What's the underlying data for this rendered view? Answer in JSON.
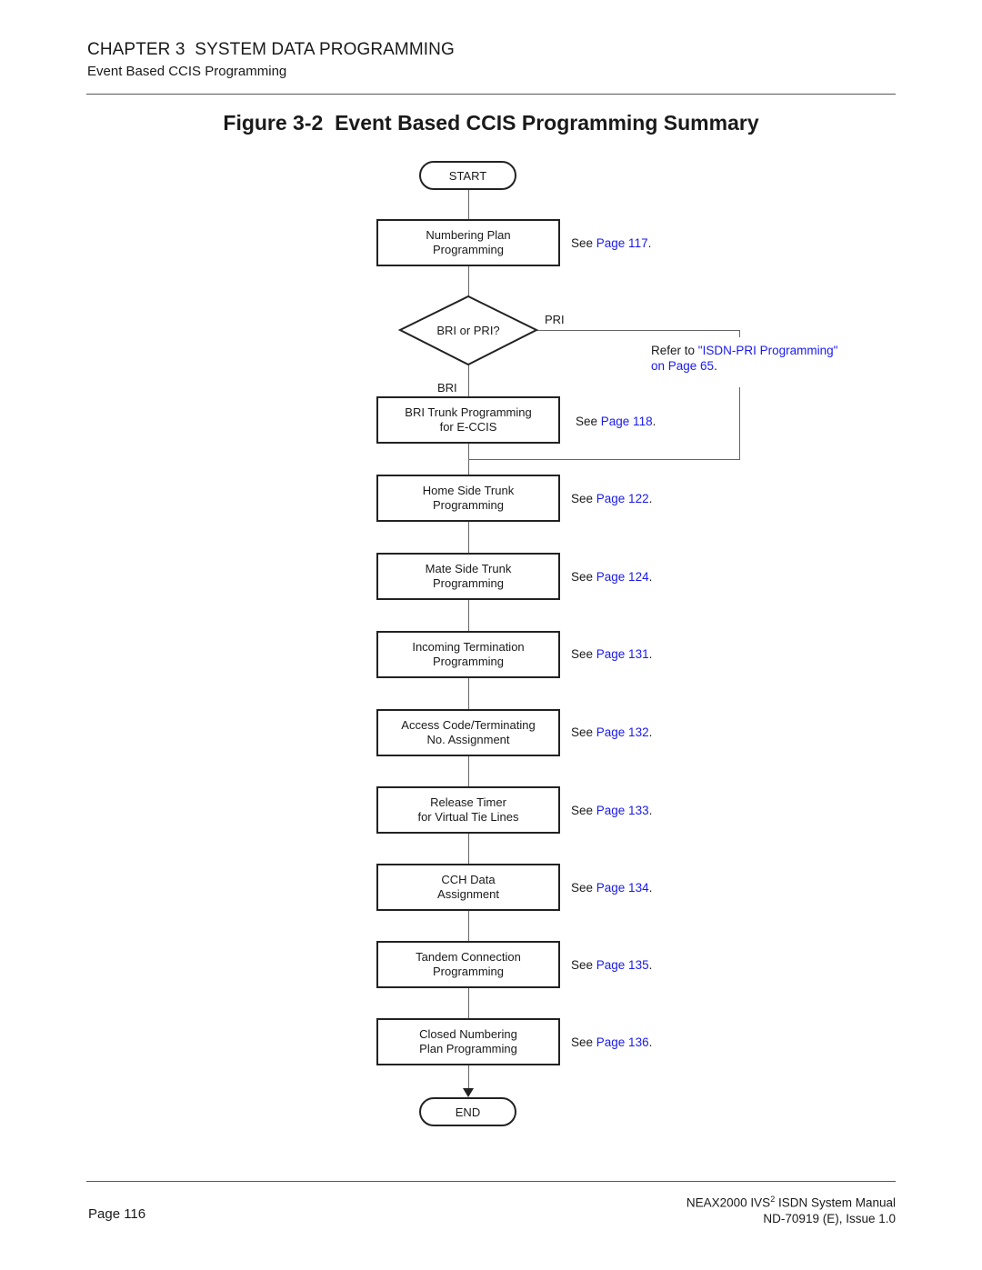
{
  "header": {
    "chapter": "CHAPTER 3  SYSTEM DATA PROGRAMMING",
    "section": "Event Based CCIS Programming"
  },
  "figure": {
    "title": "Figure 3-2  Event Based CCIS Programming Summary"
  },
  "flowchart": {
    "start_label": "START",
    "end_label": "END",
    "decision": {
      "label": "BRI or PRI?",
      "branch_right": "PRI",
      "branch_down": "BRI",
      "pri_ref_prefix": "Refer to ",
      "pri_ref_link": "\"ISDN-PRI Programming\"",
      "pri_ref_link2": "on Page 65",
      "pri_ref_suffix": "."
    },
    "steps": [
      {
        "line1": "Numbering Plan",
        "line2": "Programming",
        "see": "See ",
        "page": "Page 117",
        "dot": "."
      },
      {
        "line1": "BRI Trunk Programming",
        "line2": "for E-CCIS",
        "see": "See ",
        "page": "Page 118",
        "dot": "."
      },
      {
        "line1": "Home Side Trunk",
        "line2": "Programming",
        "see": "See ",
        "page": "Page 122",
        "dot": "."
      },
      {
        "line1": "Mate Side Trunk",
        "line2": "Programming",
        "see": "See ",
        "page": "Page 124",
        "dot": "."
      },
      {
        "line1": "Incoming Termination",
        "line2": "Programming",
        "see": "See ",
        "page": "Page 131",
        "dot": "."
      },
      {
        "line1": "Access Code/Terminating",
        "line2": "No. Assignment",
        "see": "See ",
        "page": "Page 132",
        "dot": "."
      },
      {
        "line1": "Release Timer",
        "line2": "for Virtual Tie Lines",
        "see": "See ",
        "page": "Page 133",
        "dot": "."
      },
      {
        "line1": "CCH Data",
        "line2": "Assignment",
        "see": "See ",
        "page": "Page 134",
        "dot": "."
      },
      {
        "line1": "Tandem Connection",
        "line2": "Programming",
        "see": "See ",
        "page": "Page 135",
        "dot": "."
      },
      {
        "line1": "Closed Numbering",
        "line2": "Plan Programming",
        "see": "See ",
        "page": "Page 136",
        "dot": "."
      }
    ]
  },
  "footer": {
    "page": "Page 116",
    "manual_prefix": "NEAX2000 IVS",
    "manual_sup": "2",
    "manual_suffix": " ISDN System Manual",
    "doc_id": "ND-70919 (E), Issue 1.0"
  }
}
